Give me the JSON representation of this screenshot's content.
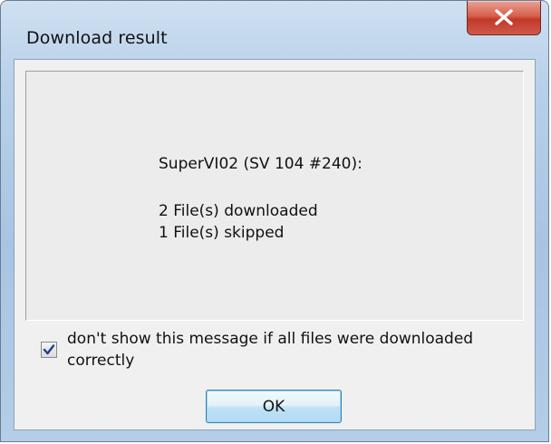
{
  "window": {
    "title": "Download result",
    "close_icon": "close-x-icon"
  },
  "message": {
    "device_line": "SuperVI02 (SV 104 #240):",
    "downloaded_line": "2 File(s) downloaded",
    "skipped_line": "1 File(s) skipped"
  },
  "option": {
    "checked": true,
    "label": "don't show this message if all files were downloaded correctly"
  },
  "buttons": {
    "ok_label": "OK"
  },
  "colors": {
    "close_button": "#c0392b",
    "ok_button_border": "#3c7fb1",
    "checkmark": "#1f3f8f"
  }
}
